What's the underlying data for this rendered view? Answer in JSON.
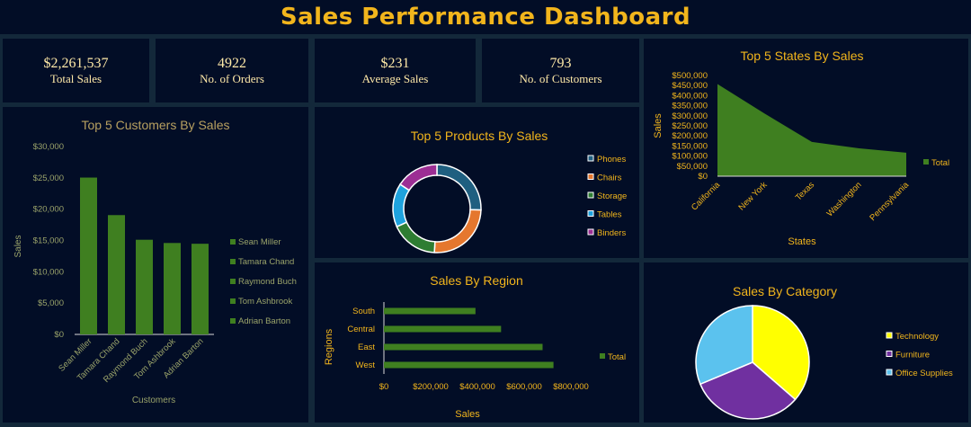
{
  "header": {
    "title": "Sales Performance Dashboard"
  },
  "kpis": [
    {
      "value": "$2,261,537",
      "label": "Total Sales"
    },
    {
      "value": "4922",
      "label": "No. of Orders"
    },
    {
      "value": "$231",
      "label": "Average Sales"
    },
    {
      "value": "793",
      "label": "No. of Customers"
    }
  ],
  "colors": {
    "accent": "#f2b51c",
    "panel": "#020d26",
    "frame": "#13283a",
    "bar_green": "#3f7f20"
  },
  "chart_data": [
    {
      "id": "customers",
      "type": "bar",
      "title": "Top 5 Customers By Sales",
      "xlabel": "Customers",
      "ylabel": "Sales",
      "categories": [
        "Sean Miller",
        "Tamara Chand",
        "Raymond Buch",
        "Tom Ashbrook",
        "Adrian Barton"
      ],
      "values": [
        25043,
        19052,
        15117,
        14596,
        14474
      ],
      "ylim": [
        0,
        30000
      ],
      "yticks": [
        0,
        5000,
        10000,
        15000,
        20000,
        25000,
        30000
      ],
      "ytick_labels": [
        "$0",
        "$5,000",
        "$10,000",
        "$15,000",
        "$20,000",
        "$25,000",
        "$30,000"
      ],
      "legend": [
        "Sean Miller",
        "Tamara Chand",
        "Raymond Buch",
        "Tom Ashbrook",
        "Adrian Barton"
      ],
      "legend_position": "right",
      "color": "#3f7f20"
    },
    {
      "id": "products",
      "type": "pie",
      "donut": true,
      "title": "Top 5 Products By Sales",
      "categories": [
        "Phones",
        "Chairs",
        "Storage",
        "Tables",
        "Binders"
      ],
      "values": [
        330007,
        328449,
        223844,
        206966,
        203413
      ],
      "colors": [
        "#1f5f80",
        "#e5772e",
        "#2e7d32",
        "#1ea2dd",
        "#9c2e94"
      ],
      "legend_position": "right"
    },
    {
      "id": "states",
      "type": "area",
      "title": "Top 5 States By Sales",
      "xlabel": "States",
      "ylabel": "Sales",
      "categories": [
        "California",
        "New York",
        "Texas",
        "Washington",
        "Pennsylvania"
      ],
      "series": [
        {
          "name": "Total",
          "values": [
            457688,
            310876,
            170188,
            138641,
            116512
          ]
        }
      ],
      "ylim": [
        0,
        500000
      ],
      "yticks": [
        0,
        50000,
        100000,
        150000,
        200000,
        250000,
        300000,
        350000,
        400000,
        450000,
        500000
      ],
      "ytick_labels": [
        "$0",
        "$50,000",
        "$100,000",
        "$150,000",
        "$200,000",
        "$250,000",
        "$300,000",
        "$350,000",
        "$400,000",
        "$450,000",
        "$500,000"
      ],
      "legend_position": "right",
      "color": "#3f7f20"
    },
    {
      "id": "region",
      "type": "bar",
      "orientation": "horizontal",
      "title": "Sales By Region",
      "xlabel": "Sales",
      "ylabel": "Regions",
      "categories": [
        "South",
        "Central",
        "East",
        "West"
      ],
      "series": [
        {
          "name": "Total",
          "values": [
            391722,
            501240,
            678781,
            725458
          ]
        }
      ],
      "xlim": [
        0,
        900000
      ],
      "xticks": [
        0,
        200000,
        400000,
        600000,
        800000
      ],
      "xtick_labels": [
        "$0",
        "$200,000",
        "$400,000",
        "$600,000",
        "$800,000"
      ],
      "legend_position": "right",
      "color": "#3f7f20"
    },
    {
      "id": "category",
      "type": "pie",
      "title": "Sales By Category",
      "categories": [
        "Technology",
        "Furniture",
        "Office Supplies"
      ],
      "values": [
        836154,
        741999,
        719047
      ],
      "colors": [
        "#ffff00",
        "#7030a0",
        "#5bc2ee"
      ],
      "legend_position": "right"
    }
  ]
}
